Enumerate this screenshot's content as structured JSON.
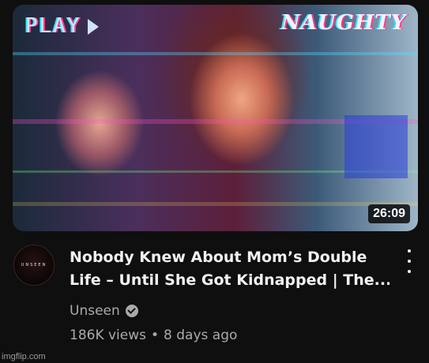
{
  "thumbnail": {
    "overlay_left": "PLAY",
    "overlay_right": "NAUGHTY",
    "duration": "26:09"
  },
  "channel": {
    "avatar_text": "UNSEEN",
    "name": "Unseen",
    "verified_icon": "verified-check-icon"
  },
  "video": {
    "title_line1": "Nobody Knew About Mom’s Double",
    "title_line2": "Life – Until She Got Kidnapped | The...",
    "views": "186K views",
    "separator": "•",
    "age": "8 days ago"
  },
  "menu_icon": "more-vert-icon",
  "watermark": "imgflip.com"
}
